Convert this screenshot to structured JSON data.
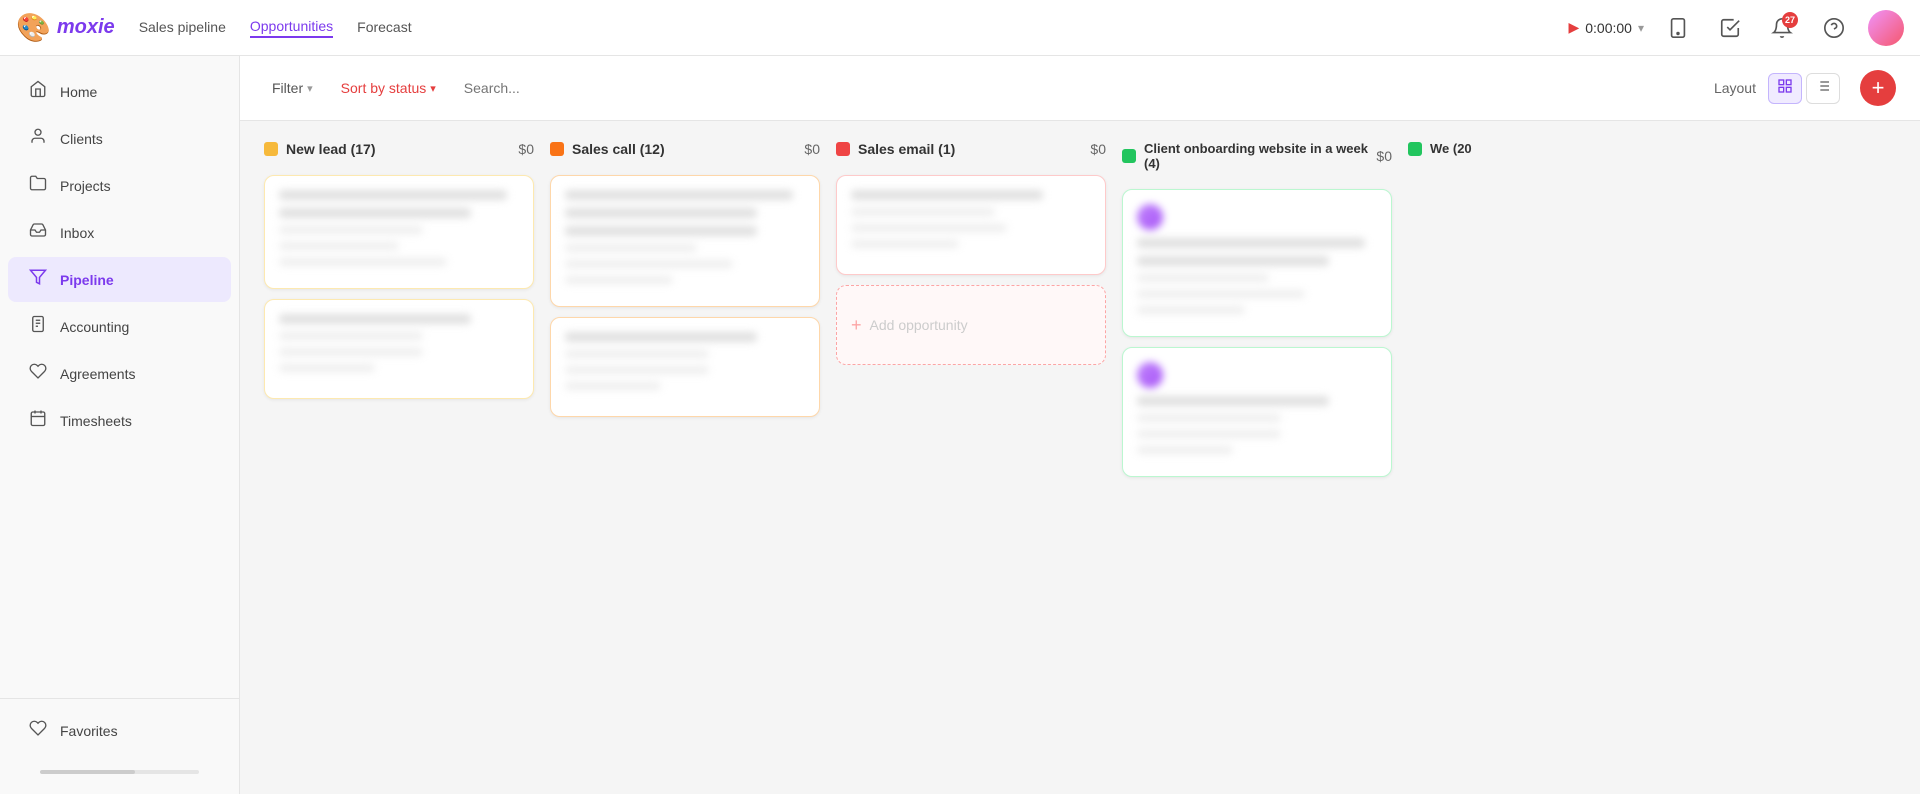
{
  "app": {
    "logo_text": "moxie",
    "logo_emoji": "🎨"
  },
  "topnav": {
    "links": [
      {
        "id": "sales-pipeline",
        "label": "Sales pipeline",
        "active": false
      },
      {
        "id": "opportunities",
        "label": "Opportunities",
        "active": true
      },
      {
        "id": "forecast",
        "label": "Forecast",
        "active": false
      }
    ],
    "timer": "0:00:00",
    "notification_count": "27"
  },
  "sidebar": {
    "items": [
      {
        "id": "home",
        "label": "Home",
        "icon": "🏠"
      },
      {
        "id": "clients",
        "label": "Clients",
        "icon": "👤"
      },
      {
        "id": "projects",
        "label": "Projects",
        "icon": "📁"
      },
      {
        "id": "inbox",
        "label": "Inbox",
        "icon": "📥"
      },
      {
        "id": "pipeline",
        "label": "Pipeline",
        "icon": "⬇",
        "active": true
      },
      {
        "id": "accounting",
        "label": "Accounting",
        "icon": "📊"
      },
      {
        "id": "agreements",
        "label": "Agreements",
        "icon": "🎁"
      },
      {
        "id": "timesheets",
        "label": "Timesheets",
        "icon": "⏰"
      }
    ],
    "bottom": [
      {
        "id": "favorites",
        "label": "Favorites",
        "icon": "🤍"
      }
    ]
  },
  "toolbar": {
    "filter_label": "Filter",
    "sort_label": "Sort by status",
    "search_placeholder": "Search...",
    "layout_label": "Layout",
    "add_label": "+"
  },
  "kanban": {
    "columns": [
      {
        "id": "new-lead",
        "title": "New lead",
        "count": 17,
        "amount": "$0",
        "color": "yellow",
        "dot_color": "#f6b93b",
        "bg": "#fffbf0",
        "cards": [
          {
            "id": "c1",
            "blurred": true,
            "lines": [
              "long",
              "medium",
              "short",
              "thin",
              "thin"
            ]
          },
          {
            "id": "c2",
            "blurred": true,
            "lines": [
              "medium",
              "short",
              "thin",
              "thin"
            ]
          }
        ],
        "add": false
      },
      {
        "id": "sales-call",
        "title": "Sales call",
        "count": 12,
        "amount": "$0",
        "color": "orange",
        "dot_color": "#f97316",
        "bg": "#fff7f0",
        "cards": [
          {
            "id": "c3",
            "blurred": true,
            "lines": [
              "long",
              "medium",
              "medium",
              "thin",
              "thin",
              "thin"
            ]
          },
          {
            "id": "c4",
            "blurred": true,
            "lines": [
              "medium",
              "short",
              "thin",
              "thin"
            ]
          }
        ],
        "add": false
      },
      {
        "id": "sales-email",
        "title": "Sales email",
        "count": 1,
        "amount": "$0",
        "color": "red",
        "dot_color": "#ef4444",
        "bg": "#fff5f5",
        "cards": [
          {
            "id": "c5",
            "blurred": true,
            "lines": [
              "medium",
              "short",
              "thin",
              "thin"
            ]
          }
        ],
        "add": true,
        "add_label": "+ Add opportunity"
      },
      {
        "id": "client-onboarding",
        "title": "Client onboarding website in a week",
        "count": 4,
        "amount": "$0",
        "color": "green",
        "dot_color": "#22c55e",
        "bg": "#f0fff4",
        "cards": [
          {
            "id": "c6",
            "blurred": true,
            "has_avatar": true,
            "avatar_color": "purple",
            "lines": [
              "long",
              "medium",
              "short",
              "thin",
              "thin"
            ]
          },
          {
            "id": "c7",
            "blurred": true,
            "has_avatar": true,
            "avatar_color": "purple",
            "lines": [
              "medium",
              "short",
              "thin",
              "thin"
            ]
          }
        ],
        "add": false
      },
      {
        "id": "col5",
        "title": "We",
        "count_prefix": "(20",
        "color": "green2",
        "dot_color": "#22c55e",
        "partial": true,
        "cards": [],
        "add": false
      }
    ]
  }
}
